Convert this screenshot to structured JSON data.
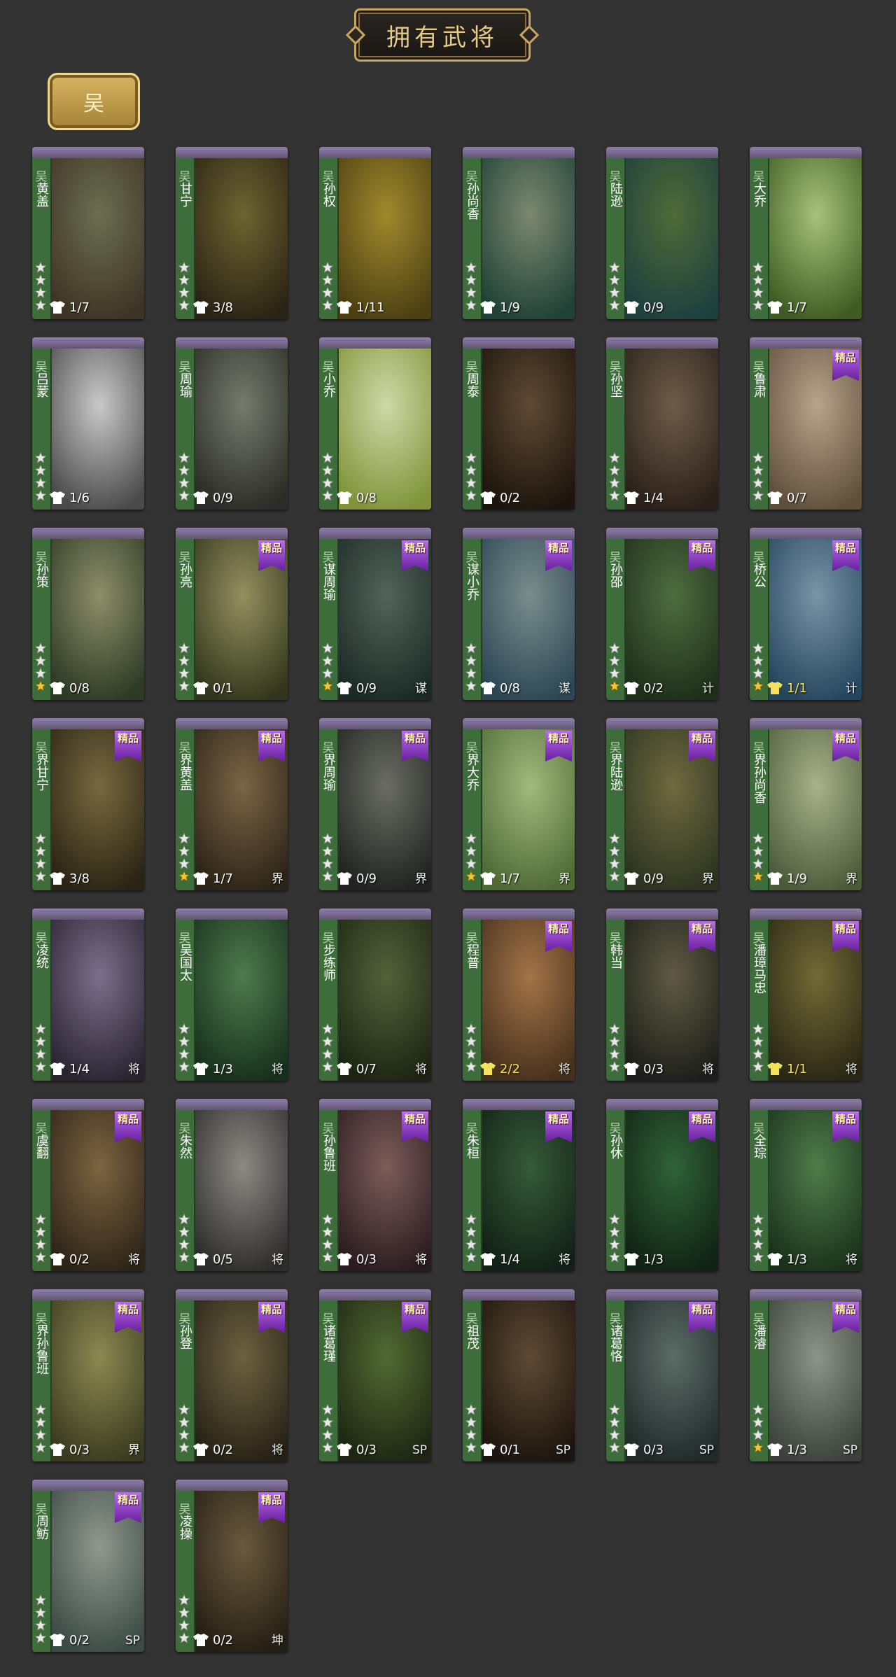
{
  "page": {
    "title": "拥有武将"
  },
  "faction_tab": {
    "label": "吴"
  },
  "faction_glyph": "吴",
  "colors": {
    "background": "#333333",
    "sidebar": "#3d6d3a",
    "gold": "#c9a75c",
    "premium": "#8a2fc4"
  },
  "premium_label": "精品",
  "icons": {
    "skin": "shirt-icon",
    "rarity": "star-icon"
  },
  "generals": [
    {
      "name": "黄盖",
      "skins": "1/7",
      "premium": false,
      "tag": "",
      "gold_star": false,
      "gold_skin": false,
      "art": [
        "#6b6e52",
        "#3e3424"
      ]
    },
    {
      "name": "甘宁",
      "skins": "3/8",
      "premium": false,
      "tag": "",
      "gold_star": false,
      "gold_skin": false,
      "art": [
        "#6c6530",
        "#2b2314"
      ]
    },
    {
      "name": "孙权",
      "skins": "1/11",
      "premium": false,
      "tag": "",
      "gold_star": false,
      "gold_skin": false,
      "art": [
        "#a08a2c",
        "#4b3f12"
      ]
    },
    {
      "name": "孙尚香",
      "skins": "1/9",
      "premium": false,
      "tag": "",
      "gold_star": false,
      "gold_skin": false,
      "art": [
        "#7c8870",
        "#1f4136"
      ]
    },
    {
      "name": "陆逊",
      "skins": "0/9",
      "premium": false,
      "tag": "",
      "gold_star": false,
      "gold_skin": false,
      "art": [
        "#4f6b38",
        "#1d3f3e"
      ]
    },
    {
      "name": "大乔",
      "skins": "1/7",
      "premium": false,
      "tag": "",
      "gold_star": false,
      "gold_skin": false,
      "art": [
        "#a7c27a",
        "#3d5b22"
      ]
    },
    {
      "name": "吕蒙",
      "skins": "1/6",
      "premium": false,
      "tag": "",
      "gold_star": false,
      "gold_skin": false,
      "art": [
        "#c9c9c9",
        "#4a4a4a"
      ]
    },
    {
      "name": "周瑜",
      "skins": "0/9",
      "premium": false,
      "tag": "",
      "gold_star": false,
      "gold_skin": false,
      "art": [
        "#767b6d",
        "#2b2c25"
      ]
    },
    {
      "name": "小乔",
      "skins": "0/8",
      "premium": false,
      "tag": "",
      "gold_star": false,
      "gold_skin": false,
      "art": [
        "#cfd8a8",
        "#7f9438"
      ]
    },
    {
      "name": "周泰",
      "skins": "0/2",
      "premium": false,
      "tag": "",
      "gold_star": false,
      "gold_skin": false,
      "art": [
        "#5e4a34",
        "#1c140d"
      ]
    },
    {
      "name": "孙坚",
      "skins": "1/4",
      "premium": false,
      "tag": "",
      "gold_star": false,
      "gold_skin": false,
      "art": [
        "#6d5c4a",
        "#2a2019"
      ]
    },
    {
      "name": "鲁肃",
      "skins": "0/7",
      "premium": true,
      "tag": "",
      "gold_star": false,
      "gold_skin": false,
      "art": [
        "#b9a38c",
        "#5f4f3a"
      ]
    },
    {
      "name": "孙策",
      "skins": "0/8",
      "premium": false,
      "tag": "",
      "gold_star": true,
      "gold_skin": false,
      "art": [
        "#8d8e6a",
        "#2d3a24"
      ]
    },
    {
      "name": "孙亮",
      "skins": "0/1",
      "premium": true,
      "tag": "",
      "gold_star": false,
      "gold_skin": false,
      "art": [
        "#93905f",
        "#33361c"
      ]
    },
    {
      "name": "谋周瑜",
      "skins": "0/9",
      "premium": true,
      "tag": "谋",
      "gold_star": true,
      "gold_skin": false,
      "art": [
        "#53645a",
        "#1b2a25"
      ]
    },
    {
      "name": "谋小乔",
      "skins": "0/8",
      "premium": true,
      "tag": "谋",
      "gold_star": false,
      "gold_skin": false,
      "art": [
        "#7a8d8b",
        "#2c4654"
      ]
    },
    {
      "name": "孙邵",
      "skins": "0/2",
      "premium": true,
      "tag": "计",
      "gold_star": true,
      "gold_skin": false,
      "art": [
        "#4f6d3f",
        "#1e2e1a"
      ]
    },
    {
      "name": "桥公",
      "skins": "1/1",
      "premium": true,
      "tag": "计",
      "gold_star": true,
      "gold_skin": true,
      "art": [
        "#7b93a6",
        "#24465d"
      ]
    },
    {
      "name": "界甘宁",
      "skins": "3/8",
      "premium": true,
      "tag": "",
      "gold_star": false,
      "gold_skin": false,
      "art": [
        "#77693e",
        "#2b2414"
      ]
    },
    {
      "name": "界黄盖",
      "skins": "1/7",
      "premium": true,
      "tag": "界",
      "gold_star": true,
      "gold_skin": false,
      "art": [
        "#7a6445",
        "#2c2418"
      ]
    },
    {
      "name": "界周瑜",
      "skins": "0/9",
      "premium": true,
      "tag": "界",
      "gold_star": false,
      "gold_skin": false,
      "art": [
        "#6b6d62",
        "#1f2421"
      ]
    },
    {
      "name": "界大乔",
      "skins": "1/7",
      "premium": true,
      "tag": "界",
      "gold_star": true,
      "gold_skin": false,
      "art": [
        "#a2b97f",
        "#4d6a33"
      ]
    },
    {
      "name": "界陆逊",
      "skins": "0/9",
      "premium": true,
      "tag": "界",
      "gold_star": false,
      "gold_skin": false,
      "art": [
        "#6f6a3f",
        "#2c3420"
      ]
    },
    {
      "name": "界孙尚香",
      "skins": "1/9",
      "premium": true,
      "tag": "界",
      "gold_star": true,
      "gold_skin": false,
      "art": [
        "#a8b28a",
        "#4b5b3a"
      ]
    },
    {
      "name": "凌统",
      "skins": "1/4",
      "premium": false,
      "tag": "将",
      "gold_star": false,
      "gold_skin": false,
      "art": [
        "#7b6f8a",
        "#2a2431"
      ]
    },
    {
      "name": "吴国太",
      "skins": "1/3",
      "premium": false,
      "tag": "将",
      "gold_star": false,
      "gold_skin": false,
      "art": [
        "#4f7a4d",
        "#16301c"
      ]
    },
    {
      "name": "步练师",
      "skins": "0/7",
      "premium": false,
      "tag": "将",
      "gold_star": false,
      "gold_skin": false,
      "art": [
        "#54623a",
        "#1c2513"
      ]
    },
    {
      "name": "程普",
      "skins": "2/2",
      "premium": true,
      "tag": "将",
      "gold_star": false,
      "gold_skin": true,
      "art": [
        "#a37448",
        "#45301c"
      ]
    },
    {
      "name": "韩当",
      "skins": "0/3",
      "premium": true,
      "tag": "将",
      "gold_star": false,
      "gold_skin": false,
      "art": [
        "#5f5a45",
        "#1c1e18"
      ]
    },
    {
      "name": "潘璋马忠",
      "skins": "1/1",
      "premium": true,
      "tag": "将",
      "gold_star": false,
      "gold_skin": true,
      "art": [
        "#726a36",
        "#2a2714"
      ]
    },
    {
      "name": "虞翻",
      "skins": "0/2",
      "premium": true,
      "tag": "将",
      "gold_star": false,
      "gold_skin": false,
      "art": [
        "#7c6440",
        "#2d2418"
      ]
    },
    {
      "name": "朱然",
      "skins": "0/5",
      "premium": false,
      "tag": "将",
      "gold_star": false,
      "gold_skin": false,
      "art": [
        "#8b8a84",
        "#2d2c2a"
      ]
    },
    {
      "name": "孙鲁班",
      "skins": "0/3",
      "premium": true,
      "tag": "将",
      "gold_star": false,
      "gold_skin": false,
      "art": [
        "#7c5d5a",
        "#2a1c1e"
      ]
    },
    {
      "name": "朱桓",
      "skins": "1/4",
      "premium": true,
      "tag": "将",
      "gold_star": false,
      "gold_skin": false,
      "art": [
        "#355b3a",
        "#122015"
      ]
    },
    {
      "name": "孙休",
      "skins": "1/3",
      "premium": true,
      "tag": "",
      "gold_star": false,
      "gold_skin": false,
      "art": [
        "#2f6338",
        "#112214"
      ]
    },
    {
      "name": "全琮",
      "skins": "1/3",
      "premium": true,
      "tag": "将",
      "gold_star": false,
      "gold_skin": false,
      "art": [
        "#4f7c4a",
        "#1a311b"
      ]
    },
    {
      "name": "界孙鲁班",
      "skins": "0/3",
      "premium": true,
      "tag": "界",
      "gold_star": false,
      "gold_skin": false,
      "art": [
        "#8a8a52",
        "#3a3a1f"
      ]
    },
    {
      "name": "孙登",
      "skins": "0/2",
      "premium": true,
      "tag": "将",
      "gold_star": false,
      "gold_skin": false,
      "art": [
        "#6c6240",
        "#262116"
      ]
    },
    {
      "name": "诸葛瑾",
      "skins": "0/3",
      "premium": true,
      "tag": "SP",
      "gold_star": false,
      "gold_skin": false,
      "art": [
        "#536a33",
        "#1c2612"
      ]
    },
    {
      "name": "祖茂",
      "skins": "0/1",
      "premium": false,
      "tag": "SP",
      "gold_star": false,
      "gold_skin": false,
      "art": [
        "#5d4a34",
        "#1c140e"
      ]
    },
    {
      "name": "诸葛恪",
      "skins": "0/3",
      "premium": true,
      "tag": "SP",
      "gold_star": false,
      "gold_skin": false,
      "art": [
        "#5d6b66",
        "#1f2a29"
      ]
    },
    {
      "name": "潘濬",
      "skins": "1/3",
      "premium": true,
      "tag": "SP",
      "gold_star": true,
      "gold_skin": false,
      "art": [
        "#8d9488",
        "#3a4239"
      ]
    },
    {
      "name": "周鲂",
      "skins": "0/2",
      "premium": true,
      "tag": "SP",
      "gold_star": false,
      "gold_skin": false,
      "art": [
        "#8f9a8e",
        "#3c4a45"
      ]
    },
    {
      "name": "凌操",
      "skins": "0/2",
      "premium": true,
      "tag": "坤",
      "gold_star": false,
      "gold_skin": false,
      "art": [
        "#6a5a3d",
        "#241e14"
      ]
    }
  ]
}
